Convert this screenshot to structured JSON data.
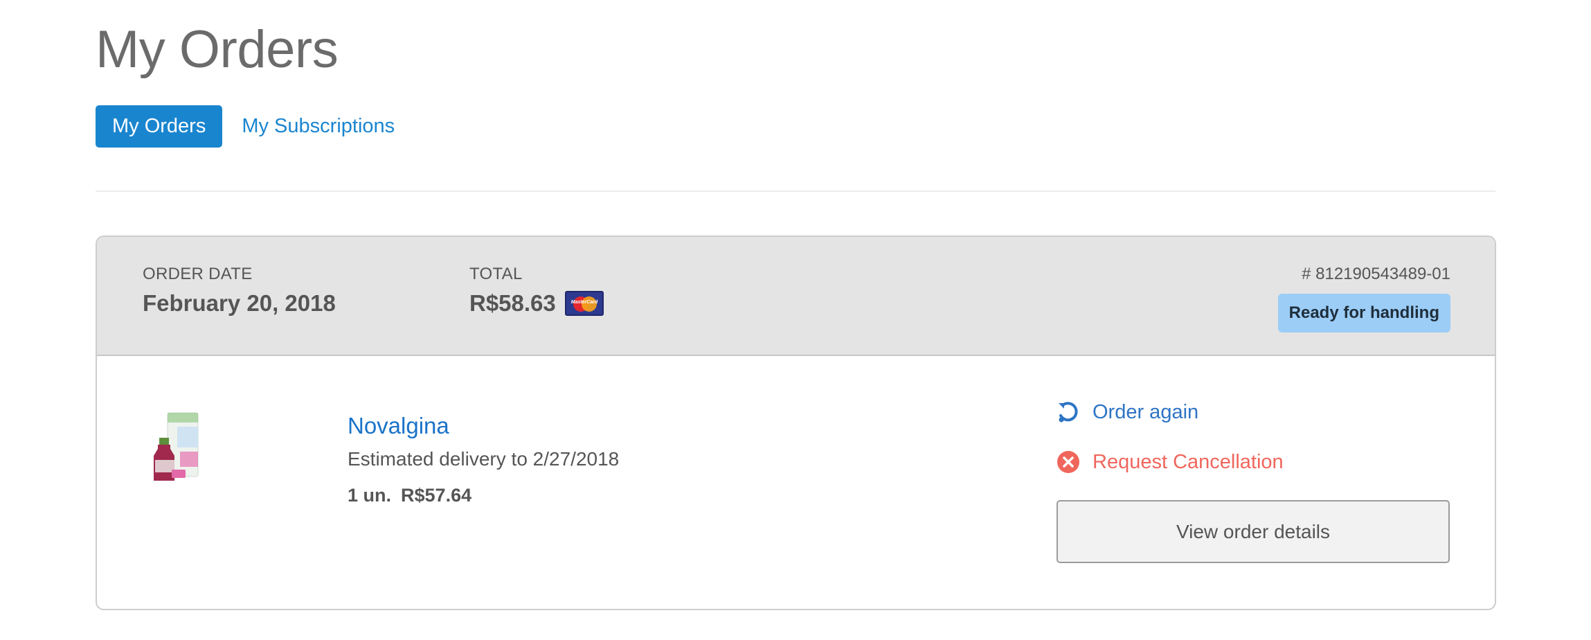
{
  "page": {
    "title": "My Orders"
  },
  "tabs": [
    {
      "label": "My Orders",
      "active": true
    },
    {
      "label": "My Subscriptions",
      "active": false
    }
  ],
  "order": {
    "date_label": "ORDER DATE",
    "date_value": "February 20, 2018",
    "total_label": "TOTAL",
    "total_value": "R$58.63",
    "payment_icon": "mastercard-icon",
    "payment_icon_text": "MasterCard",
    "order_number": "# 812190543489-01",
    "status": "Ready for handling",
    "items": [
      {
        "name": "Novalgina",
        "image_icon": "product-image",
        "delivery": "Estimated delivery to 2/27/2018",
        "quantity": "1 un.",
        "price": "R$57.64"
      }
    ],
    "actions": {
      "order_again": "Order again",
      "request_cancellation": "Request Cancellation",
      "view_details": "View order details"
    }
  },
  "colors": {
    "accent": "#1a85cf",
    "link": "#1a73c8",
    "status_badge_bg": "#9ccdf7",
    "cancel": "#f0665c",
    "header_bg": "#e4e4e4"
  }
}
